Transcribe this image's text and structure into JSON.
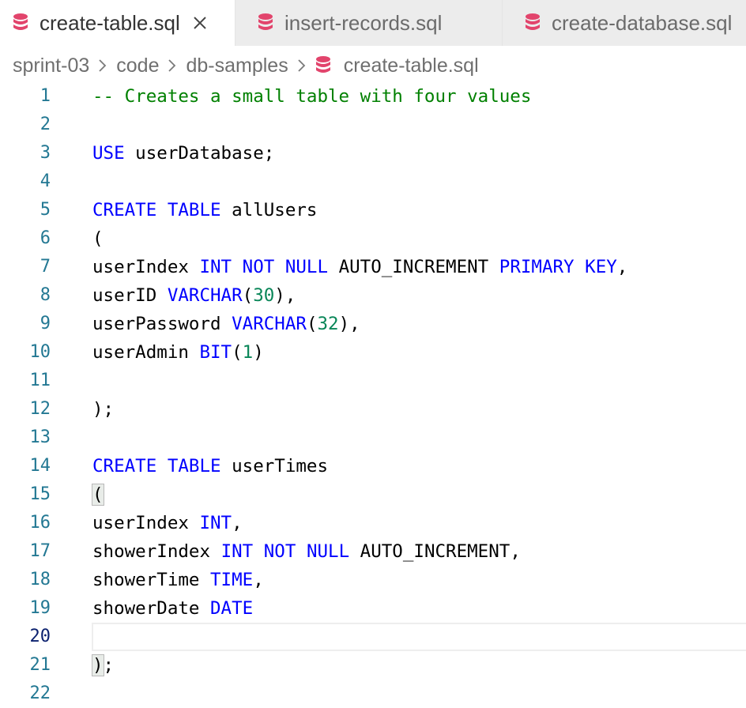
{
  "tabs": [
    {
      "label": "create-table.sql",
      "active": true,
      "closable": true,
      "icon": "database-icon"
    },
    {
      "label": "insert-records.sql",
      "active": false,
      "closable": false,
      "icon": "database-icon"
    },
    {
      "label": "create-database.sql",
      "active": false,
      "closable": false,
      "icon": "database-icon"
    }
  ],
  "breadcrumb": [
    "sprint-03",
    "code",
    "db-samples",
    "create-table.sql"
  ],
  "colors": {
    "keyword": "#0000ff",
    "number": "#098658",
    "comment": "#008000",
    "line_number": "#237893",
    "db_icon": "#e2446c"
  },
  "editor": {
    "current_line": 20,
    "lines": [
      {
        "n": "1",
        "tokens": [
          {
            "t": "-- Creates a small table with four values",
            "k": "com"
          }
        ]
      },
      {
        "n": "2",
        "tokens": []
      },
      {
        "n": "3",
        "tokens": [
          {
            "t": "USE",
            "k": "kw"
          },
          {
            "t": " userDatabase;",
            "k": "plain"
          }
        ]
      },
      {
        "n": "4",
        "tokens": []
      },
      {
        "n": "5",
        "tokens": [
          {
            "t": "CREATE",
            "k": "kw"
          },
          {
            "t": " ",
            "k": "plain"
          },
          {
            "t": "TABLE",
            "k": "kw"
          },
          {
            "t": " allUsers",
            "k": "plain"
          }
        ]
      },
      {
        "n": "6",
        "tokens": [
          {
            "t": "(",
            "k": "plain"
          }
        ]
      },
      {
        "n": "7",
        "tokens": [
          {
            "t": "userIndex ",
            "k": "plain"
          },
          {
            "t": "INT",
            "k": "kw"
          },
          {
            "t": " ",
            "k": "plain"
          },
          {
            "t": "NOT",
            "k": "kw"
          },
          {
            "t": " ",
            "k": "plain"
          },
          {
            "t": "NULL",
            "k": "kw"
          },
          {
            "t": " AUTO_INCREMENT ",
            "k": "plain"
          },
          {
            "t": "PRIMARY",
            "k": "kw"
          },
          {
            "t": " ",
            "k": "plain"
          },
          {
            "t": "KEY",
            "k": "kw"
          },
          {
            "t": ",",
            "k": "plain"
          }
        ]
      },
      {
        "n": "8",
        "tokens": [
          {
            "t": "userID ",
            "k": "plain"
          },
          {
            "t": "VARCHAR",
            "k": "kw"
          },
          {
            "t": "(",
            "k": "plain"
          },
          {
            "t": "30",
            "k": "num"
          },
          {
            "t": "),",
            "k": "plain"
          }
        ]
      },
      {
        "n": "9",
        "tokens": [
          {
            "t": "userPassword ",
            "k": "plain"
          },
          {
            "t": "VARCHAR",
            "k": "kw"
          },
          {
            "t": "(",
            "k": "plain"
          },
          {
            "t": "32",
            "k": "num"
          },
          {
            "t": "),",
            "k": "plain"
          }
        ]
      },
      {
        "n": "10",
        "tokens": [
          {
            "t": "userAdmin ",
            "k": "plain"
          },
          {
            "t": "BIT",
            "k": "kw"
          },
          {
            "t": "(",
            "k": "plain"
          },
          {
            "t": "1",
            "k": "num"
          },
          {
            "t": ")",
            "k": "plain"
          }
        ]
      },
      {
        "n": "11",
        "tokens": []
      },
      {
        "n": "12",
        "tokens": [
          {
            "t": ");",
            "k": "plain"
          }
        ]
      },
      {
        "n": "13",
        "tokens": []
      },
      {
        "n": "14",
        "tokens": [
          {
            "t": "CREATE",
            "k": "kw"
          },
          {
            "t": " ",
            "k": "plain"
          },
          {
            "t": "TABLE",
            "k": "kw"
          },
          {
            "t": " userTimes",
            "k": "plain"
          }
        ]
      },
      {
        "n": "15",
        "tokens": [
          {
            "t": "(",
            "k": "bm"
          }
        ]
      },
      {
        "n": "16",
        "tokens": [
          {
            "t": "userIndex ",
            "k": "plain"
          },
          {
            "t": "INT",
            "k": "kw"
          },
          {
            "t": ",",
            "k": "plain"
          }
        ]
      },
      {
        "n": "17",
        "tokens": [
          {
            "t": "showerIndex ",
            "k": "plain"
          },
          {
            "t": "INT",
            "k": "kw"
          },
          {
            "t": " ",
            "k": "plain"
          },
          {
            "t": "NOT",
            "k": "kw"
          },
          {
            "t": " ",
            "k": "plain"
          },
          {
            "t": "NULL",
            "k": "kw"
          },
          {
            "t": " AUTO_INCREMENT,",
            "k": "plain"
          }
        ]
      },
      {
        "n": "18",
        "tokens": [
          {
            "t": "showerTime ",
            "k": "plain"
          },
          {
            "t": "TIME",
            "k": "kw"
          },
          {
            "t": ",",
            "k": "plain"
          }
        ]
      },
      {
        "n": "19",
        "tokens": [
          {
            "t": "showerDate ",
            "k": "plain"
          },
          {
            "t": "DATE",
            "k": "kw"
          }
        ]
      },
      {
        "n": "20",
        "tokens": []
      },
      {
        "n": "21",
        "tokens": [
          {
            "t": ")",
            "k": "bm"
          },
          {
            "t": ";",
            "k": "plain"
          }
        ]
      },
      {
        "n": "22",
        "tokens": []
      }
    ]
  }
}
